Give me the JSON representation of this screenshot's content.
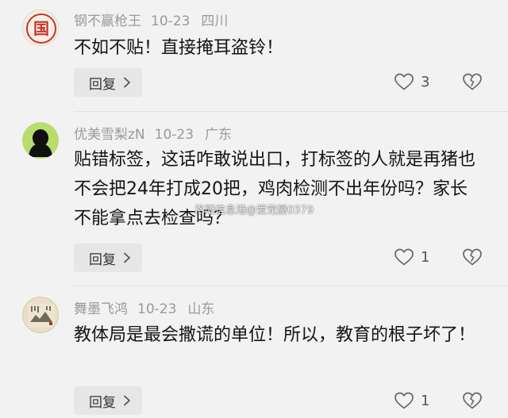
{
  "comments": [
    {
      "username": "钢不赢枪王",
      "date": "10-23",
      "location": "四川",
      "avatar_text": "国",
      "content": "不如不贴！直接掩耳盗铃！",
      "reply_label": "回复",
      "like_count": "3"
    },
    {
      "username": "优美雪梨zN",
      "date": "10-23",
      "location": "广东",
      "content": "贴错标签，这话咋敢说出口，打标签的人就是再猪也不会把24年打成20把，鸡肉检测不出年份吗？家长不能拿点去检查吗？",
      "reply_label": "回复",
      "like_count": "1"
    },
    {
      "username": "舞墨飞鸿",
      "date": "10-23",
      "location": "山东",
      "content": "教体局是最会撒谎的单位！所以，教育的根子坏了！",
      "reply_label": "回复",
      "like_count": "1"
    }
  ],
  "watermark": "洛阳信息港@爱宠屋0379",
  "colors": {
    "background": "#f2f2f2",
    "meta_text": "#9a9a9a",
    "content_text": "#141414",
    "reply_button_bg": "#e6e6e6"
  },
  "icons": {
    "like": "heart-outline-icon",
    "dislike": "broken-heart-icon",
    "reply_arrow": "chevron-right-icon"
  }
}
